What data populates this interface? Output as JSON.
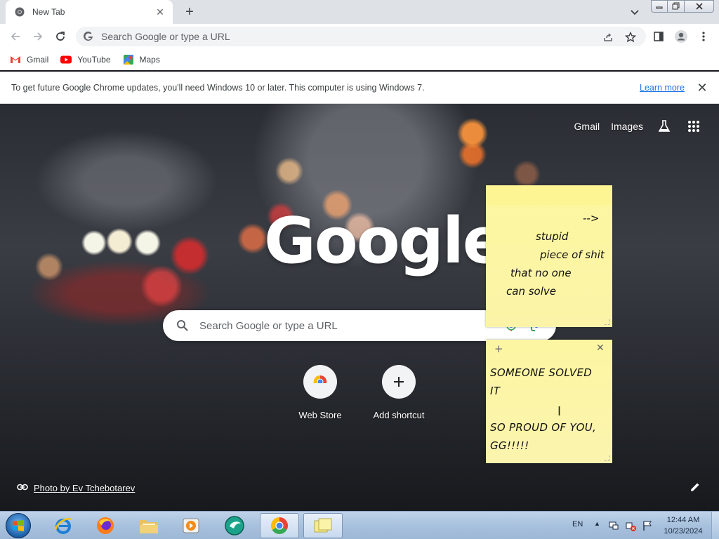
{
  "tab": {
    "title": "New Tab"
  },
  "omnibox": {
    "placeholder": "Search Google or type a URL"
  },
  "bookmarks": [
    {
      "label": "Gmail",
      "icon": "gmail-icon"
    },
    {
      "label": "YouTube",
      "icon": "youtube-icon"
    },
    {
      "label": "Maps",
      "icon": "maps-icon"
    }
  ],
  "infobar": {
    "message": "To get future Google Chrome updates, you'll need Windows 10 or later. This computer is using Windows 7.",
    "learn_more": "Learn more"
  },
  "ntp": {
    "links": {
      "gmail": "Gmail",
      "images": "Images"
    },
    "logo": "Google",
    "search_placeholder": "Search Google or type a URL",
    "shortcuts": [
      {
        "label": "Web Store",
        "icon": "chrome-web-store-icon"
      },
      {
        "label": "Add shortcut",
        "icon": "plus-icon"
      }
    ],
    "attribution": "Photo by Ev Tchebotarev"
  },
  "sticky_notes": [
    {
      "lines": [
        "-->",
        "stupid",
        "piece of shit",
        "that no one",
        "can solve"
      ]
    },
    {
      "lines": [
        "SOMEONE SOLVED",
        "IT",
        "SO PROUD OF YOU,",
        "GG!!!!!"
      ]
    }
  ],
  "taskbar": {
    "apps": [
      "internet-explorer-icon",
      "firefox-icon",
      "file-explorer-icon",
      "media-player-icon",
      "app-icon",
      "chrome-icon",
      "sticky-notes-icon"
    ],
    "language": "EN",
    "time": "12:44 AM",
    "date": "10/23/2024"
  },
  "colors": {
    "accent": "#1a73e8",
    "sticky": "#fcf7a5",
    "taskbar": "#a8c1dd"
  }
}
